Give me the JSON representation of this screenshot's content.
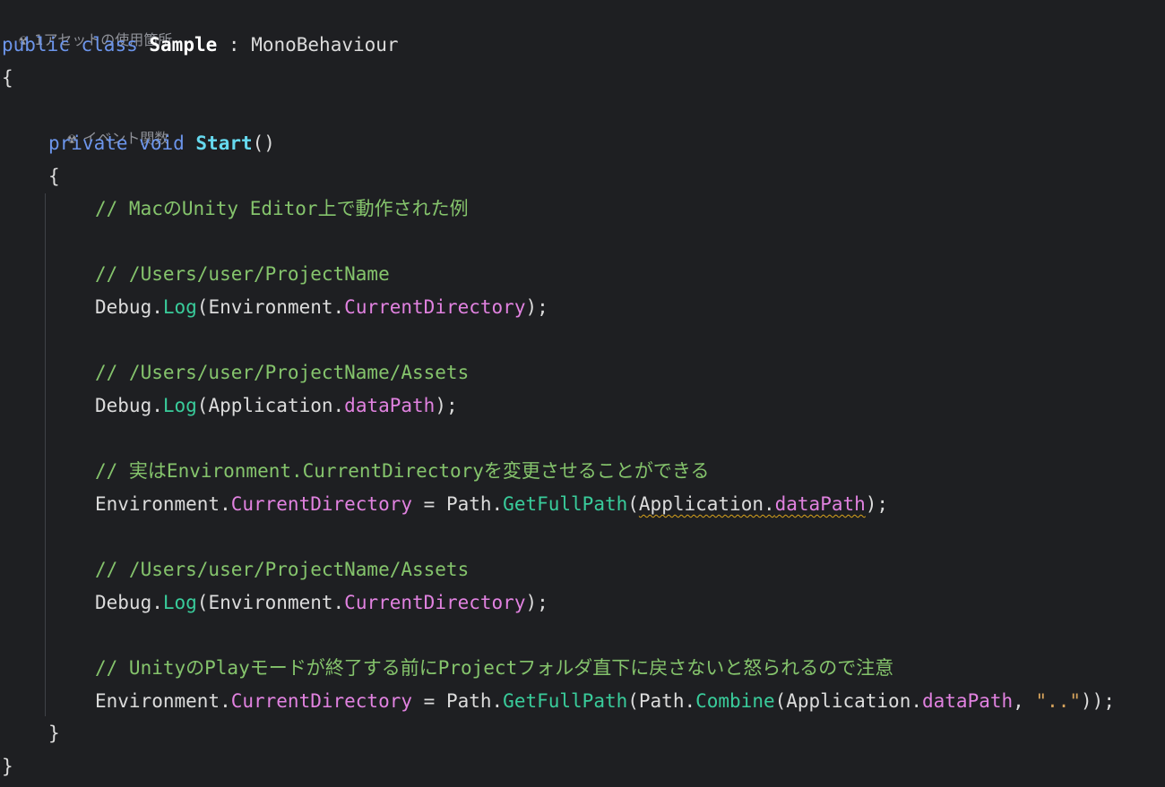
{
  "hints": [
    {
      "icon": "unity-icon",
      "text": "1アセットの使用箇所"
    },
    {
      "icon": "unity-icon",
      "text": "イベント関数"
    }
  ],
  "lines": [
    [
      {
        "t": "kw",
        "v": "public"
      },
      {
        "t": "plain",
        "v": " "
      },
      {
        "t": "kw",
        "v": "class"
      },
      {
        "t": "plain",
        "v": " "
      },
      {
        "t": "cls",
        "v": "Sample"
      },
      {
        "t": "plain",
        "v": " : "
      },
      {
        "t": "plain",
        "v": "MonoBehaviour"
      }
    ],
    [
      {
        "t": "plain",
        "v": "{"
      }
    ],
    [
      {
        "t": "kw",
        "v": "private"
      },
      {
        "t": "plain",
        "v": " "
      },
      {
        "t": "kw",
        "v": "void"
      },
      {
        "t": "plain",
        "v": " "
      },
      {
        "t": "fn-decl",
        "v": "Start"
      },
      {
        "t": "plain",
        "v": "()"
      }
    ],
    [
      {
        "t": "plain",
        "v": "{"
      }
    ],
    [
      {
        "t": "com",
        "v": "// MacのUnity Editor上で動作された例"
      }
    ],
    [],
    [
      {
        "t": "com",
        "v": "// /Users/user/ProjectName"
      }
    ],
    [
      {
        "t": "plain",
        "v": "Debug."
      },
      {
        "t": "fn",
        "v": "Log"
      },
      {
        "t": "plain",
        "v": "(Environment."
      },
      {
        "t": "prop",
        "v": "CurrentDirectory"
      },
      {
        "t": "plain",
        "v": ");"
      }
    ],
    [],
    [
      {
        "t": "com",
        "v": "// /Users/user/ProjectName/Assets"
      }
    ],
    [
      {
        "t": "plain",
        "v": "Debug."
      },
      {
        "t": "fn",
        "v": "Log"
      },
      {
        "t": "plain",
        "v": "(Application."
      },
      {
        "t": "prop",
        "v": "dataPath"
      },
      {
        "t": "plain",
        "v": ");"
      }
    ],
    [],
    [
      {
        "t": "com",
        "v": "// 実はEnvironment.CurrentDirectoryを変更させることができる"
      }
    ],
    [
      {
        "t": "plain",
        "v": "Environment."
      },
      {
        "t": "prop",
        "v": "CurrentDirectory"
      },
      {
        "t": "plain",
        "v": " = Path."
      },
      {
        "t": "fn",
        "v": "GetFullPath"
      },
      {
        "t": "plain",
        "v": "("
      },
      {
        "t": "plain",
        "v": "Application.",
        "sq": true
      },
      {
        "t": "prop",
        "v": "dataPath",
        "sq": true
      },
      {
        "t": "plain",
        "v": ");"
      }
    ],
    [],
    [
      {
        "t": "com",
        "v": "// /Users/user/ProjectName/Assets"
      }
    ],
    [
      {
        "t": "plain",
        "v": "Debug."
      },
      {
        "t": "fn",
        "v": "Log"
      },
      {
        "t": "plain",
        "v": "(Environment."
      },
      {
        "t": "prop",
        "v": "CurrentDirectory"
      },
      {
        "t": "plain",
        "v": ");"
      }
    ],
    [],
    [
      {
        "t": "com",
        "v": "// UnityのPlayモードが終了する前にProjectフォルダ直下に戻さないと怒られるので注意"
      }
    ],
    [
      {
        "t": "plain",
        "v": "Environment."
      },
      {
        "t": "prop",
        "v": "CurrentDirectory"
      },
      {
        "t": "plain",
        "v": " = Path."
      },
      {
        "t": "fn",
        "v": "GetFullPath"
      },
      {
        "t": "plain",
        "v": "(Path."
      },
      {
        "t": "fn",
        "v": "Combine"
      },
      {
        "t": "plain",
        "v": "(Application."
      },
      {
        "t": "prop",
        "v": "dataPath"
      },
      {
        "t": "plain",
        "v": ", "
      },
      {
        "t": "str",
        "v": "\"..\""
      },
      {
        "t": "plain",
        "v": "));"
      }
    ],
    [
      {
        "t": "plain",
        "v": "}"
      }
    ],
    [
      {
        "t": "plain",
        "v": "}"
      }
    ]
  ]
}
